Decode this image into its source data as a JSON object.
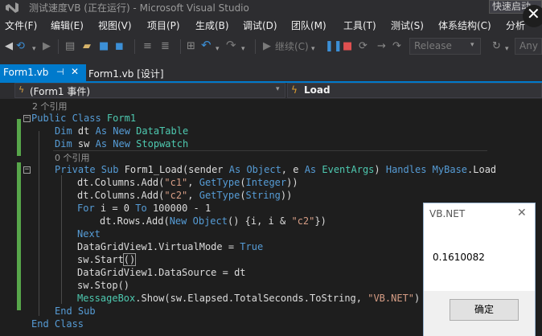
{
  "window": {
    "title": "测试速度VB (正在运行) - Microsoft Visual Studio",
    "quick_launch": "快速启动"
  },
  "menu": [
    "文件(F)",
    "编辑(E)",
    "视图(V)",
    "项目(P)",
    "生成(B)",
    "调试(D)",
    "团队(M)",
    "工具(T)",
    "测试(S)",
    "体系结构(C)",
    "分析"
  ],
  "toolbar": {
    "continue_label": "继续(C)",
    "configuration": "Release",
    "platform": "Any C"
  },
  "tabs": [
    {
      "label": "Form1.vb",
      "active": true
    },
    {
      "label": "Form1.vb [设计]",
      "active": false
    }
  ],
  "navbar": {
    "class_dropdown": "(Form1 事件)",
    "member_dropdown": "Load"
  },
  "code": {
    "lens_class": "2 个引用",
    "lens_sub": "0 个引用",
    "lines": {
      "l1_kw1": "Public Class",
      "l1_name": " Form1",
      "l2_kw": "Dim",
      "l2_mid": " dt ",
      "l2_kw2": "As New",
      "l2_type": " DataTable",
      "l3_kw": "Dim",
      "l3_mid": " sw ",
      "l3_kw2": "As New",
      "l3_type": " Stopwatch",
      "l4_kw": "Private Sub",
      "l4_a": " Form1_Load(sender ",
      "l4_as1": "As",
      "l4_t1": " Object",
      "l4_b": ", e ",
      "l4_as2": "As",
      "l4_t2": " EventArgs",
      "l4_c": ") ",
      "l4_h": "Handles",
      "l4_d": " ",
      "l4_mb": "MyBase",
      "l4_e": ".Load",
      "l5_a": "dt.Columns.Add(",
      "l5_s": "\"c1\"",
      "l5_b": ", ",
      "l5_g": "GetType",
      "l5_c": "(",
      "l5_t": "Integer",
      "l5_d": "))",
      "l6_a": "dt.Columns.Add(",
      "l6_s": "\"c2\"",
      "l6_b": ", ",
      "l6_g": "GetType",
      "l6_c": "(",
      "l6_t": "String",
      "l6_d": "))",
      "l7_for": "For",
      "l7_a": " i = 0 ",
      "l7_to": "To",
      "l7_b": " 100000 - 1",
      "l8_a": "dt.Rows.Add(",
      "l8_new": "New",
      "l8_b": " ",
      "l8_obj": "Object",
      "l8_c": "() {i, i & ",
      "l8_s": "\"c2\"",
      "l8_d": "})",
      "l9_next": "Next",
      "l10_a": "DataGridView1.VirtualMode = ",
      "l10_true": "True",
      "l11_a": "sw.Start",
      "l11_b": "()",
      "l12_a": "DataGridView1.DataSource = dt",
      "l13_a": "sw.Stop()",
      "l14_mb": "MessageBox",
      "l14_a": ".Show(sw.Elapsed.TotalSeconds.ToString, ",
      "l14_s": "\"VB.NET\"",
      "l14_b": ")",
      "l15_kw": "End Sub",
      "l16_kw": "End Class"
    }
  },
  "messagebox": {
    "title": "VB.NET",
    "message": "0.1610082",
    "ok_label": "确定"
  },
  "colors": {
    "accent": "#007acc",
    "keyword": "#569cd6",
    "type": "#4ec9b0",
    "string": "#d69d85",
    "change_bar": "#57a64a"
  }
}
